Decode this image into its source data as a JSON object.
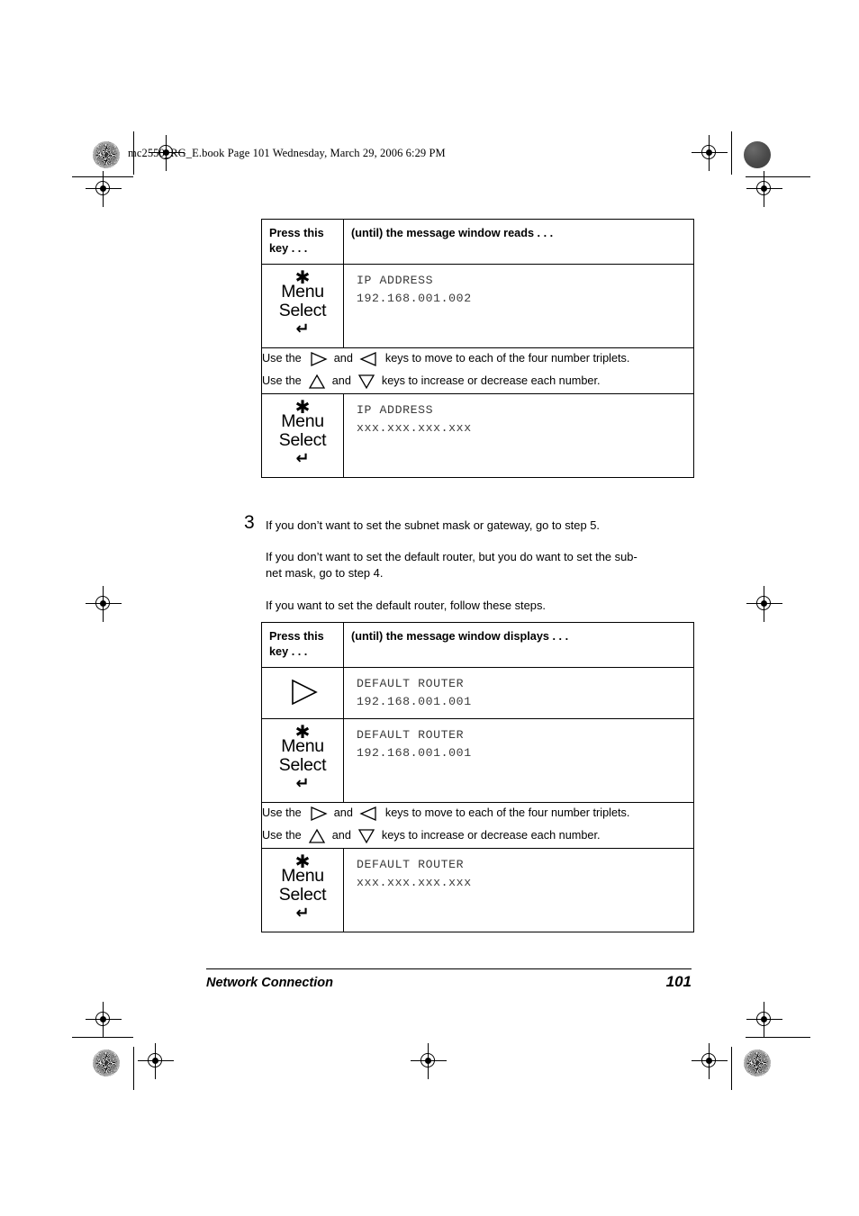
{
  "page": {
    "file_header": "mc2550_RG_E.book  Page 101  Wednesday, March 29, 2006  6:29 PM",
    "footer_title": "Network Connection",
    "footer_page": "101"
  },
  "table_ip": {
    "header": {
      "key_column": "Press this\nkey . . .",
      "key_column_line1": "Press this",
      "key_column_line2": "key . . .",
      "message_column": "(until) the message window reads  . . ."
    },
    "rows": [
      {
        "key": {
          "type": "menu-select-key",
          "star": "✱",
          "menu": "Menu",
          "select": "Select",
          "return": "↵"
        },
        "message_line1": "IP ADDRESS",
        "message_line2": "192.168.001.002"
      },
      {
        "type": "instruction",
        "line1_a": "Use the",
        "line1_icon1": "right-arrow",
        "line1_b": "and",
        "line1_icon2": "left-arrow",
        "line1_c": "keys to move to each of the four number triplets.",
        "line2_a": "Use the",
        "line2_icon1": "up-arrow",
        "line2_b": "and",
        "line2_icon2": "down-arrow",
        "line2_c": "keys to increase or decrease each number."
      },
      {
        "key": {
          "type": "menu-select-key",
          "star": "✱",
          "menu": "Menu",
          "select": "Select",
          "return": "↵"
        },
        "message_line1": "IP ADDRESS",
        "message_line2": "xxx.xxx.xxx.xxx"
      }
    ]
  },
  "step3": {
    "number": "3",
    "paragraph1": "If you don’t want to set the subnet mask or gateway, go to step 5.",
    "paragraph2": "If you don’t want to set the default router, but you do want to set the sub-net mask, go to step 4.",
    "paragraph2_line1": "If you don’t want to set the default router, but you do want to set the sub-",
    "paragraph2_line2": "net mask, go to step 4.",
    "paragraph3": "If you want to set the default router, follow these steps."
  },
  "table_router": {
    "header": {
      "key_column_line1": "Press this",
      "key_column_line2": "key . . .",
      "message_column": "(until) the message window displays . . ."
    },
    "rows": [
      {
        "key": {
          "type": "right-arrow-key"
        },
        "message_line1": "DEFAULT ROUTER",
        "message_line2": "192.168.001.001"
      },
      {
        "key": {
          "type": "menu-select-key",
          "star": "✱",
          "menu": "Menu",
          "select": "Select",
          "return": "↵"
        },
        "message_line1": "DEFAULT ROUTER",
        "message_line2": "192.168.001.001"
      },
      {
        "type": "instruction",
        "line1_a": "Use the",
        "line1_b": "and",
        "line1_c": "keys to move to each of the four number triplets.",
        "line2_a": "Use the",
        "line2_b": "and",
        "line2_c": "keys to increase or decrease each number."
      },
      {
        "key": {
          "type": "menu-select-key",
          "star": "✱",
          "menu": "Menu",
          "select": "Select",
          "return": "↵"
        },
        "message_line1": "DEFAULT ROUTER",
        "message_line2": "xxx.xxx.xxx.xxx"
      }
    ]
  },
  "colors": {
    "ink": "#000000",
    "lcd_text": "#3a3a3a",
    "paper": "#ffffff"
  }
}
